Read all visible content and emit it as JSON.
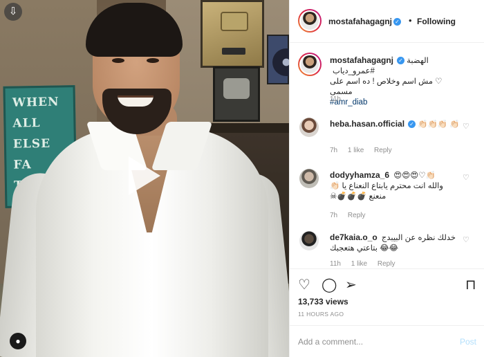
{
  "header": {
    "username": "mostafahagagnj",
    "follow_label": "Following",
    "separator": "•"
  },
  "caption": {
    "username": "mostafahagagnj",
    "text_line1": "الهضبة #عمرو_دياب",
    "text_line2": "♡ مش اسم وخلاص ! ده اسم على مسمى",
    "hashtag": "#amr_diab",
    "time": "11h"
  },
  "comments": [
    {
      "username": "heba.hasan.official",
      "text": "👏🏻👏🏻👏🏻 👏🏻",
      "time": "7h",
      "likes": "1 like",
      "reply": "Reply"
    },
    {
      "username": "dodyyhamza_6",
      "text": "😍😍😍♡👏🏻",
      "text_line2": "والله انت محترم يابتاع النعناع يا 👏🏻",
      "text_line3": "منعنع 💣💣💣☠",
      "time": "7h",
      "reply": "Reply"
    },
    {
      "username": "de7kaia.o_o",
      "text": "خدلك نظره عن البيبدج",
      "text_line2": "😂😂 بتاعتي هتعجبك",
      "time": "11h",
      "likes": "1 like",
      "reply": "Reply"
    }
  ],
  "stats": {
    "views": "13,733 views",
    "time_ago": "11 HOURS AGO"
  },
  "comment_box": {
    "placeholder": "Add a comment...",
    "post_label": "Post"
  },
  "media": {
    "sign_words": [
      "WHEN",
      "ALL",
      "ELSE",
      "FA",
      "T"
    ]
  },
  "icons": {
    "download": "⇩",
    "verified": "✓",
    "heart": "♡",
    "comment": "◯",
    "share": "➢",
    "bookmark": "⊓",
    "user": "●"
  },
  "colors": {
    "verified_blue": "#3897f0",
    "post_disabled": "#b2dffc",
    "muted": "#8e8e8e",
    "hashtag": "#003569"
  }
}
